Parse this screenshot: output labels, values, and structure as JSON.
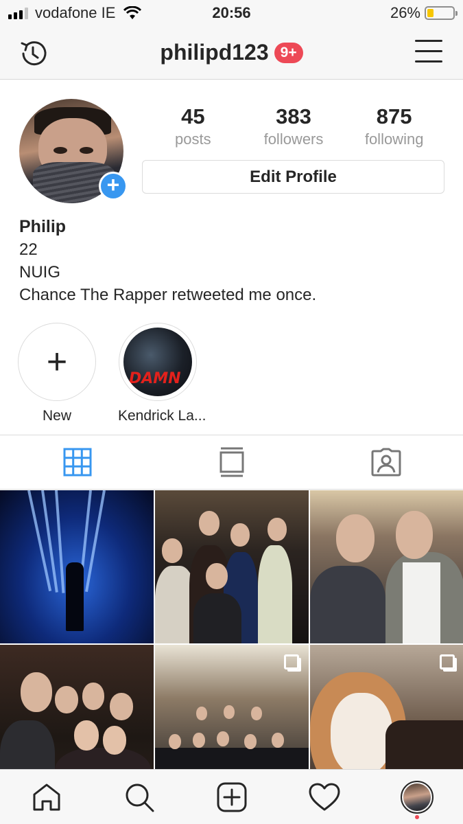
{
  "status_bar": {
    "carrier": "vodafone IE",
    "time": "20:56",
    "battery": "26%",
    "battery_level": 0.26
  },
  "nav": {
    "username": "philipd123",
    "notification_badge": "9+"
  },
  "profile": {
    "stats": [
      {
        "value": "45",
        "label": "posts"
      },
      {
        "value": "383",
        "label": "followers"
      },
      {
        "value": "875",
        "label": "following"
      }
    ],
    "edit_button": "Edit Profile",
    "name": "Philip",
    "bio_lines": [
      "22",
      "NUIG",
      "Chance The Rapper retweeted me once."
    ]
  },
  "highlights": [
    {
      "label": "New",
      "icon": "plus-icon"
    },
    {
      "label": "Kendrick La...",
      "cover_text": "DAMN"
    }
  ],
  "tabs": [
    {
      "name": "grid",
      "icon": "grid-icon",
      "active": true,
      "active_color": "#3897f0"
    },
    {
      "name": "feed",
      "icon": "feed-icon",
      "active": false
    },
    {
      "name": "tagged",
      "icon": "tagged-person-icon",
      "active": false
    }
  ],
  "bottom_nav": [
    {
      "icon": "home-icon"
    },
    {
      "icon": "search-icon"
    },
    {
      "icon": "add-post-icon"
    },
    {
      "icon": "heart-icon"
    },
    {
      "icon": "profile-avatar-icon",
      "has_dot": true
    }
  ],
  "colors": {
    "accent_blue": "#3897f0",
    "badge_red": "#ed4956"
  }
}
